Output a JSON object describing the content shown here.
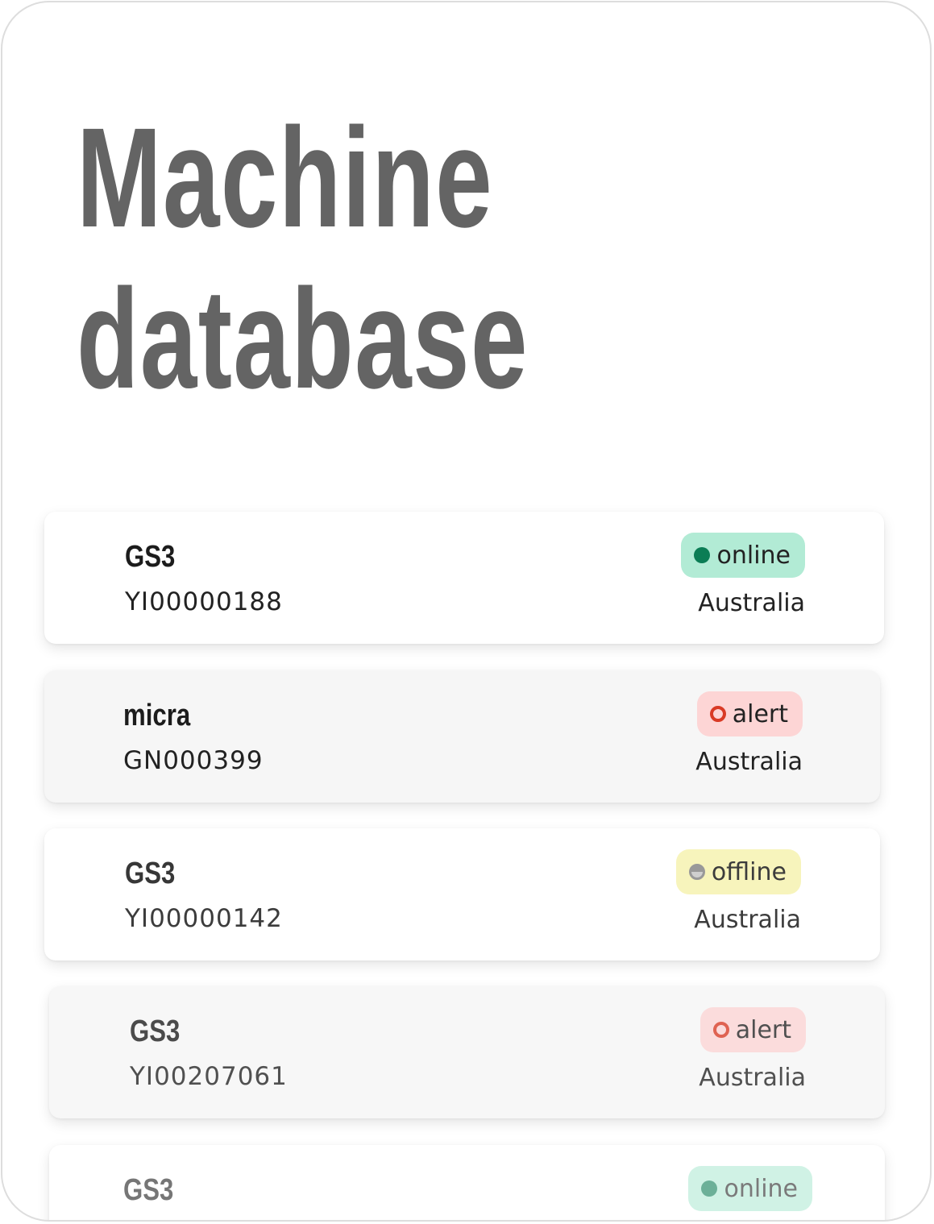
{
  "title": {
    "line1": "Machine",
    "line2": "database"
  },
  "machines": [
    {
      "model": "GS3",
      "serial": "YI00000188",
      "status": "online",
      "country": "Australia"
    },
    {
      "model": "micra",
      "serial": "GN000399",
      "status": "alert",
      "country": "Australia"
    },
    {
      "model": "GS3",
      "serial": "YI00000142",
      "status": "offline",
      "country": "Australia"
    },
    {
      "model": "GS3",
      "serial": "YI00207061",
      "status": "alert",
      "country": "Australia"
    },
    {
      "model": "GS3",
      "serial": "",
      "status": "online",
      "country": ""
    }
  ],
  "colors": {
    "title": "#646464",
    "online_bg": "#b2ebd5",
    "online_dot": "#0b7d55",
    "alert_bg": "#fdd5d5",
    "alert_dot": "#d93a25",
    "offline_bg": "#f7f3b3",
    "offline_dot": "#8c8c8c"
  },
  "icons": {
    "online": "filled-circle-icon",
    "alert": "ring-icon",
    "offline": "half-circle-icon"
  }
}
